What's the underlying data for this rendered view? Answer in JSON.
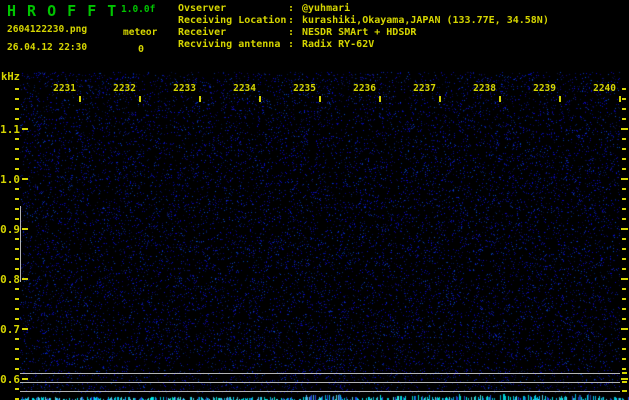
{
  "app": {
    "title": "H R O F F T",
    "version": "1.0.0f"
  },
  "file_info": {
    "filename": "2604122230.png",
    "datetime": "26.04.12 22:30"
  },
  "meteor": {
    "label": "meteor",
    "count": "0"
  },
  "station": {
    "rows": [
      {
        "label": "Ovserver",
        "sep": ":",
        "value": "@yuhmari"
      },
      {
        "label": "Receiving Location",
        "sep": ":",
        "value": "kurashiki,Okayama,JAPAN (133.77E, 34.58N)"
      },
      {
        "label": "Receiver",
        "sep": ":",
        "value": "NESDR SMArt + HDSDR"
      },
      {
        "label": "Recviving antenna",
        "sep": ":",
        "value": "Radix RY-62V"
      }
    ]
  },
  "spectrogram": {
    "type": "spectrogram",
    "freq_unit": "kHz",
    "freq_ticks": [
      "1.1",
      "1.0",
      "0.9",
      "0.8",
      "0.7",
      "0.6"
    ],
    "freq_range_khz": [
      0.6,
      1.1
    ],
    "time_ticks": [
      "2231",
      "2232",
      "2233",
      "2234",
      "2235",
      "2236",
      "2237",
      "2238",
      "2239",
      "2240"
    ],
    "echo_count": 0,
    "content": "background noise only, no meteor echoes",
    "bottom_strip": "signal level trace (cyan)"
  },
  "colors": {
    "background": "#000000",
    "text_yellow": "#d6d600",
    "title_green": "#00c400",
    "noise_blue": "#0000a0",
    "signal_cyan": "#00d8d8",
    "reference_gray": "#b4b4b4"
  }
}
